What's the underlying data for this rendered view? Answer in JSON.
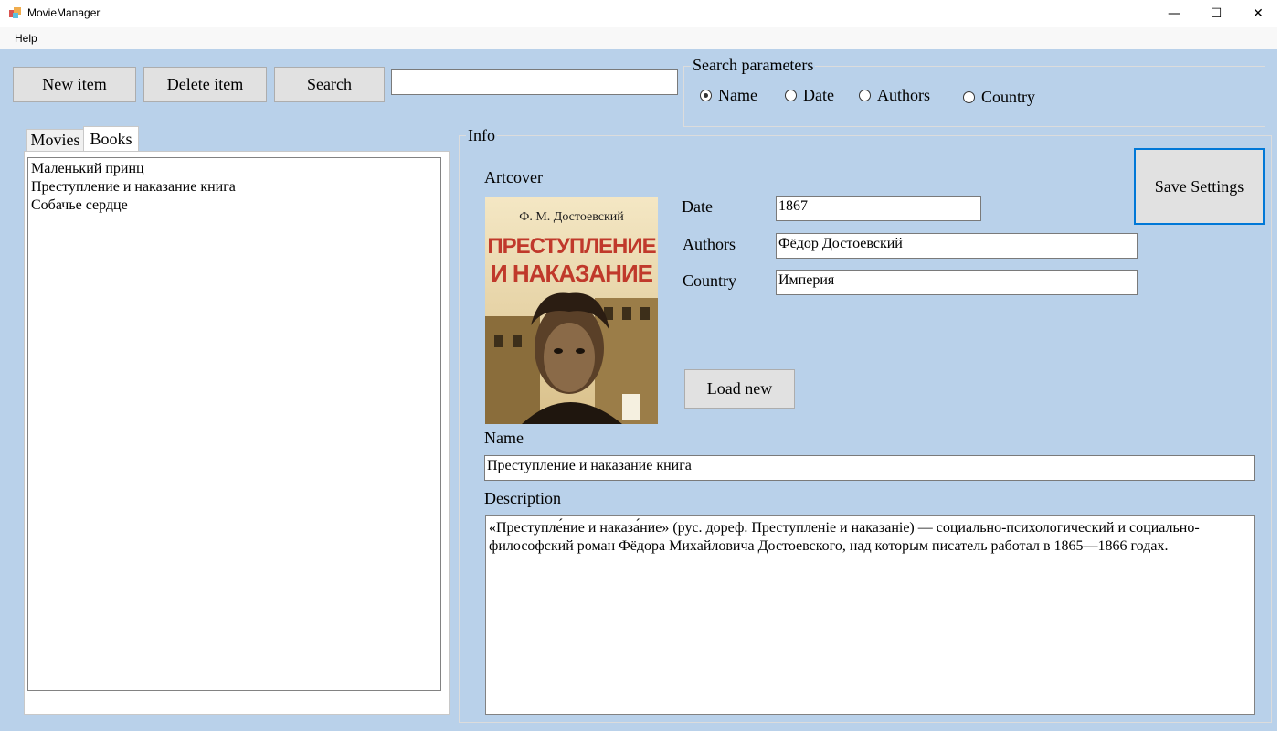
{
  "window": {
    "title": "MovieManager",
    "minimize_glyph": "—",
    "maximize_glyph": "☐",
    "close_glyph": "✕"
  },
  "menu": {
    "help": "Help"
  },
  "toolbar": {
    "new_item": "New item",
    "delete_item": "Delete item",
    "search": "Search",
    "search_value": ""
  },
  "search_params": {
    "caption": "Search parameters",
    "options": [
      "Name",
      "Date",
      "Authors",
      "Country"
    ],
    "selected": "Name"
  },
  "tabs": {
    "items": [
      "Movies",
      "Books"
    ],
    "active": "Books"
  },
  "list": {
    "items": [
      "Маленький принц",
      "Преступление и наказание книга",
      "Собачье сердце"
    ]
  },
  "info": {
    "caption": "Info",
    "artcover_label": "Artcover",
    "cover": {
      "author": "Ф. М. Достоевский",
      "title_line1": "ПРЕСТУПЛЕНИЕ",
      "title_line2": "И НАКАЗАНИЕ"
    },
    "date_label": "Date",
    "date_value": "1867",
    "authors_label": "Authors",
    "authors_value": "Фёдор Достоевский",
    "country_label": "Country",
    "country_value": " Империя",
    "load_new": "Load new",
    "save_settings": "Save Settings",
    "name_label": "Name",
    "name_value": "Преступление и наказание книга",
    "description_label": "Description",
    "description_value": "«Преступле́ние и наказа́ние» (рус. дореф. Преступленіе и наказаніе) — социально-психологический и социально-философский роман Фёдора Михайловича Достоевского, над которым писатель работал в 1865—1866 годах."
  },
  "colors": {
    "client_bg": "#b9d1ea",
    "button_bg": "#e1e1e1",
    "accent_border": "#0078d7",
    "cover_title": "#c0392b"
  }
}
